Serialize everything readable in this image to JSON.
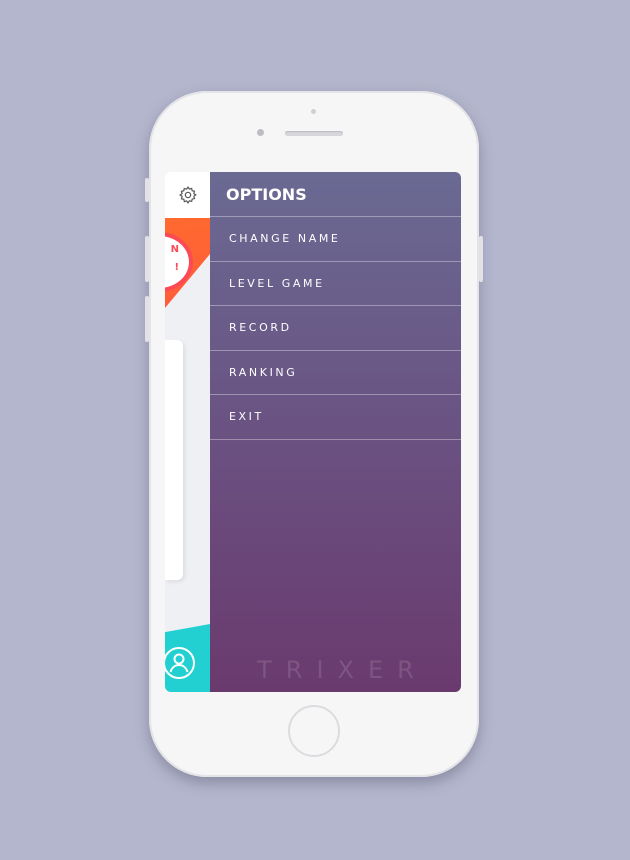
{
  "menu": {
    "title": "OPTIONS",
    "items": [
      {
        "label": "CHANGE NAME"
      },
      {
        "label": "LEVEL GAME"
      },
      {
        "label": "RECORD"
      },
      {
        "label": "RANKING"
      },
      {
        "label": "EXIT"
      }
    ]
  },
  "brand": "TRIXER",
  "partial_text": {
    "a": "N",
    "b": "!"
  },
  "colors": {
    "menu_top": "#6a6a93",
    "menu_bottom": "#6a3a6e",
    "orange": "#ff6a2f",
    "teal": "#22d0d2",
    "background": "#b4b6cd"
  },
  "icons": {
    "settings": "gear-icon",
    "profile": "user-icon"
  }
}
